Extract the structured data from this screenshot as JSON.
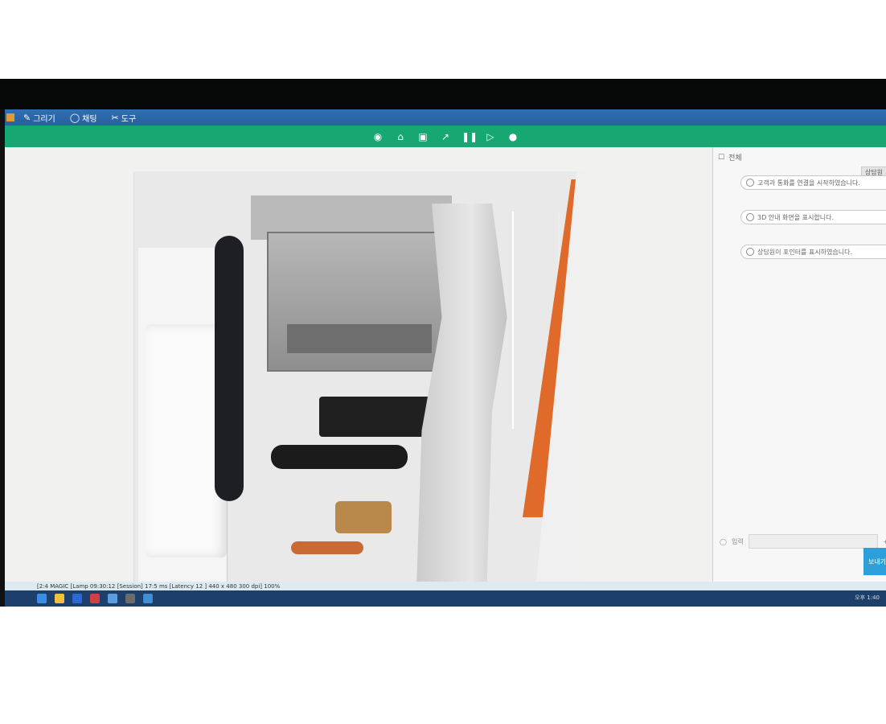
{
  "titlebar": {
    "menu": [
      {
        "icon": "pencil-icon",
        "label": "그리기"
      },
      {
        "icon": "chat-icon",
        "label": "채팅"
      },
      {
        "icon": "tools-icon",
        "label": "도구"
      }
    ]
  },
  "toolbar": {
    "icons": [
      "camera-icon",
      "home-icon",
      "capture-icon",
      "pointer-icon",
      "pause-icon",
      "video-icon",
      "location-icon"
    ]
  },
  "chat": {
    "header": "전체",
    "tag": "상담원",
    "messages": [
      {
        "text": "고객과 통화를 연결을 시작하였습니다."
      },
      {
        "text": "3D 안내 화면을 표시합니다."
      },
      {
        "text": "상담원이 포인터를 표시하였습니다."
      }
    ],
    "input_label": "입력",
    "input_placeholder": "",
    "send_label": "보내기"
  },
  "statusbar": {
    "text": "[2:4 MAGIC  [Lamp 09:30:12  [Session] 17:5 ms  [Latency 12 ]  440 x 480  300 dpi]  100%"
  },
  "tray": {
    "time": "오후 1:40"
  },
  "colors": {
    "titlebar": "#2f6fb3",
    "toolbar": "#17a773",
    "send_button": "#2e9fd8",
    "orange_panel": "#e06a2a"
  }
}
